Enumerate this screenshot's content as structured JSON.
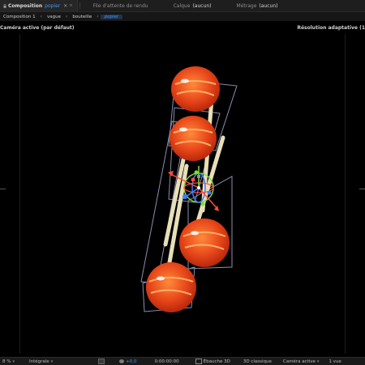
{
  "tabs": [
    {
      "name": "Composition",
      "value": "popier",
      "close": "✕",
      "menu": "≡"
    },
    {
      "muted": "File d'attente de rendu"
    },
    {
      "muted": "Calque",
      "value": "(aucun)"
    },
    {
      "muted": "Métrage",
      "value": "(aucun)"
    }
  ],
  "breadcrumbs": {
    "items": [
      "Composition 1",
      "vague",
      "bouteille",
      "popier"
    ],
    "separator": "‹"
  },
  "viewer": {
    "camera_label": "Caméra active (par défaut)",
    "resolution_label": "Résolution adaptative (1"
  },
  "status_bar": {
    "zoom": "8 %",
    "resolution": "Intégrale",
    "exposure": "+0,0",
    "timecode": "0:00:00:00",
    "draft3d": "Ébauche 3D",
    "renderer": "3D classique",
    "camera": "Caméra active",
    "views": "1 vue"
  },
  "colors": {
    "accent": "#3b9bff",
    "panel": "#1e1e1e",
    "candy": "#e8471a",
    "stick": "#e8dfb8",
    "gizmo_red": "#ff4d3d",
    "gizmo_green": "#7ddc3a",
    "gizmo_blue": "#3f7dff",
    "bbox": "#8a8fb0"
  },
  "icons": {
    "lock": "lock-icon",
    "close": "close-icon",
    "menu": "panel-menu-icon"
  }
}
